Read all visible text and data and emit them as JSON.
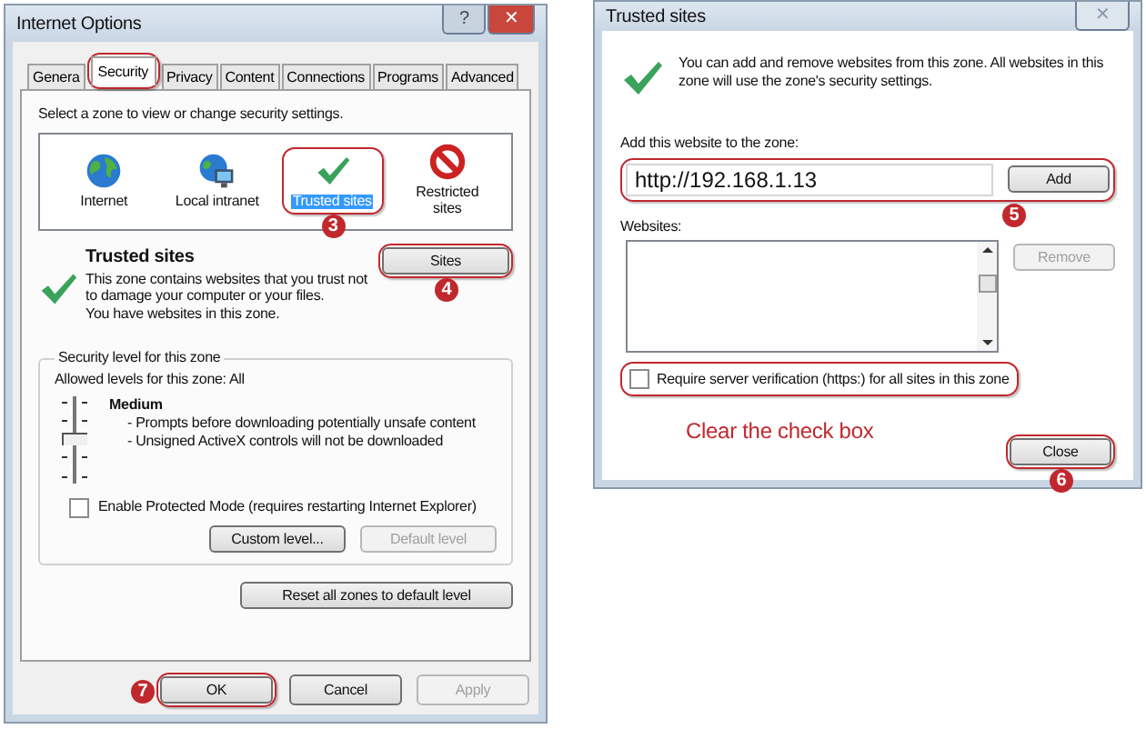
{
  "options_window": {
    "title": "Internet Options",
    "controls": [
      "?",
      "✕"
    ],
    "tabs": [
      {
        "label": "Genera",
        "selected": false,
        "highlight": false
      },
      {
        "label": "Security",
        "selected": true,
        "highlight": true
      },
      {
        "label": "Privacy",
        "selected": false,
        "highlight": false
      },
      {
        "label": "Content",
        "selected": false,
        "highlight": false
      },
      {
        "label": "Connections",
        "selected": false,
        "highlight": false
      },
      {
        "label": "Programs",
        "selected": false,
        "highlight": false
      },
      {
        "label": "Advanced",
        "selected": false,
        "highlight": false
      }
    ],
    "zone_prompt": "Select a zone to view or change security settings.",
    "zones": [
      {
        "label": "Internet",
        "kind": "globe",
        "selected": false,
        "highlight": false
      },
      {
        "label": "Local intranet",
        "kind": "intranet",
        "selected": false,
        "highlight": false
      },
      {
        "label": "Trusted sites",
        "kind": "check",
        "selected": true,
        "highlight": true,
        "step": "3"
      },
      {
        "label": "Restricted sites",
        "kind": "blocked",
        "selected": false,
        "highlight": false
      }
    ],
    "zone_title": "Trusted sites",
    "zone_description": "This zone contains websites that you trust not to damage your computer or your files.",
    "zone_note": "You have websites in this zone.",
    "sites_button": {
      "label": "Sites",
      "highlight": true,
      "step": "4"
    },
    "security": {
      "title": "Security level for this zone",
      "allowed": "Allowed levels for this zone: All",
      "level": 0.5,
      "level_name": "Medium",
      "bullets": [
        "- Prompts before downloading potentially unsafe content",
        "- Unsigned ActiveX controls will not be downloaded"
      ],
      "protected_mode": {
        "label": "Enable Protected Mode (requires restarting Internet Explorer)",
        "checked": false
      },
      "buttons": [
        {
          "label": "Custom level...",
          "disabled": false
        },
        {
          "label": "Default level",
          "disabled": true
        }
      ]
    },
    "reset_button": "Reset all zones to default level",
    "footer_buttons": [
      {
        "label": "OK",
        "disabled": false,
        "highlight": true,
        "step": "7"
      },
      {
        "label": "Cancel",
        "disabled": false,
        "highlight": false
      },
      {
        "label": "Apply",
        "disabled": true,
        "highlight": false
      }
    ]
  },
  "sites_window": {
    "title": "Trusted sites",
    "controls": [
      "✕"
    ],
    "info": "You can add and remove websites from this zone. All websites in this zone will use the zone's security settings.",
    "add_label": "Add this website to the zone:",
    "add_field": {
      "value": "http://192.168.1.13",
      "highlight": true,
      "step": "5"
    },
    "add_button": {
      "label": "Add",
      "disabled": false
    },
    "websites_label": "Websites:",
    "remove_button": {
      "label": "Remove",
      "disabled": true
    },
    "verification": {
      "label": "Require server verification (https:) for all sites in this zone",
      "checked": false,
      "highlight": true
    },
    "instruction": "Clear the check box",
    "close_button": {
      "label": "Close",
      "highlight": true,
      "step": "6"
    }
  }
}
